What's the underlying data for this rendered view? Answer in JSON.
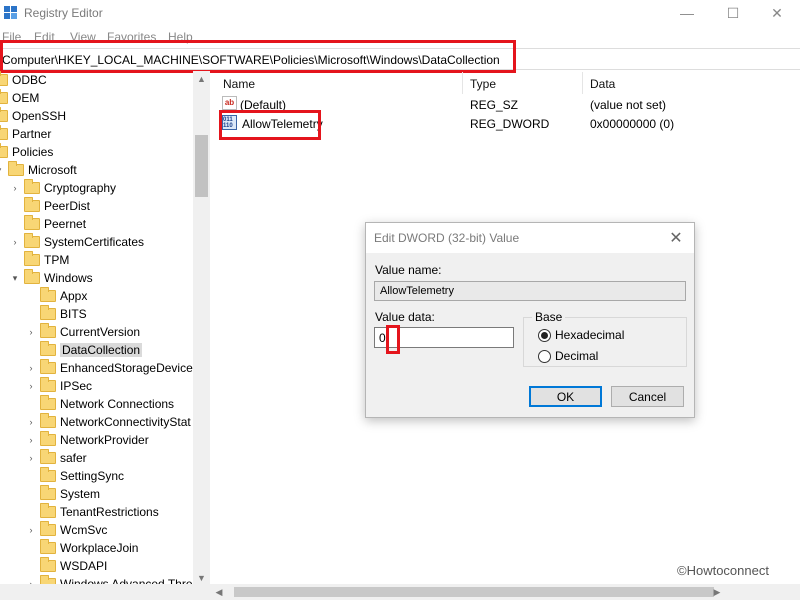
{
  "window": {
    "title": "Registry Editor"
  },
  "menu": [
    "File",
    "Edit",
    "View",
    "Favorites",
    "Help"
  ],
  "address": {
    "path": "Computer\\HKEY_LOCAL_MACHINE\\SOFTWARE\\Policies\\Microsoft\\Windows\\DataCollection"
  },
  "tree": {
    "top_items": [
      "ODBC",
      "OEM",
      "OpenSSH",
      "Partner",
      "Policies"
    ],
    "microsoft": "Microsoft",
    "microsoft_children": [
      "Cryptography",
      "PeerDist",
      "Peernet",
      "SystemCertificates",
      "TPM",
      "Windows"
    ],
    "windows_children": [
      "Appx",
      "BITS",
      "CurrentVersion",
      "DataCollection",
      "EnhancedStorageDevices",
      "IPSec",
      "Network Connections",
      "NetworkConnectivityStat",
      "NetworkProvider",
      "safer",
      "SettingSync",
      "System",
      "TenantRestrictions",
      "WcmSvc",
      "WorkplaceJoin",
      "WSDAPI"
    ],
    "last_partial": "Windows Advanced Threat P",
    "selected": "DataCollection"
  },
  "list": {
    "headers": {
      "name": "Name",
      "type": "Type",
      "data": "Data"
    },
    "rows": [
      {
        "name": "(Default)",
        "type": "REG_SZ",
        "data": "(value not set)",
        "icon": "string-value-icon",
        "icon_text": "ab"
      },
      {
        "name": "AllowTelemetry",
        "type": "REG_DWORD",
        "data": "0x00000000 (0)",
        "icon": "dword-value-icon",
        "icon_text": "011 110"
      }
    ]
  },
  "dialog": {
    "title": "Edit DWORD (32-bit) Value",
    "value_name_label": "Value name:",
    "value_name": "AllowTelemetry",
    "value_data_label": "Value data:",
    "value_data": "0",
    "base_label": "Base",
    "hex_label": "Hexadecimal",
    "dec_label": "Decimal",
    "base_selected": "Hexadecimal",
    "ok_label": "OK",
    "cancel_label": "Cancel"
  },
  "watermark": "©Howtoconnect",
  "colors": {
    "highlight": "#e4141c",
    "folder": "#f8d675",
    "accent": "#0078d7"
  }
}
